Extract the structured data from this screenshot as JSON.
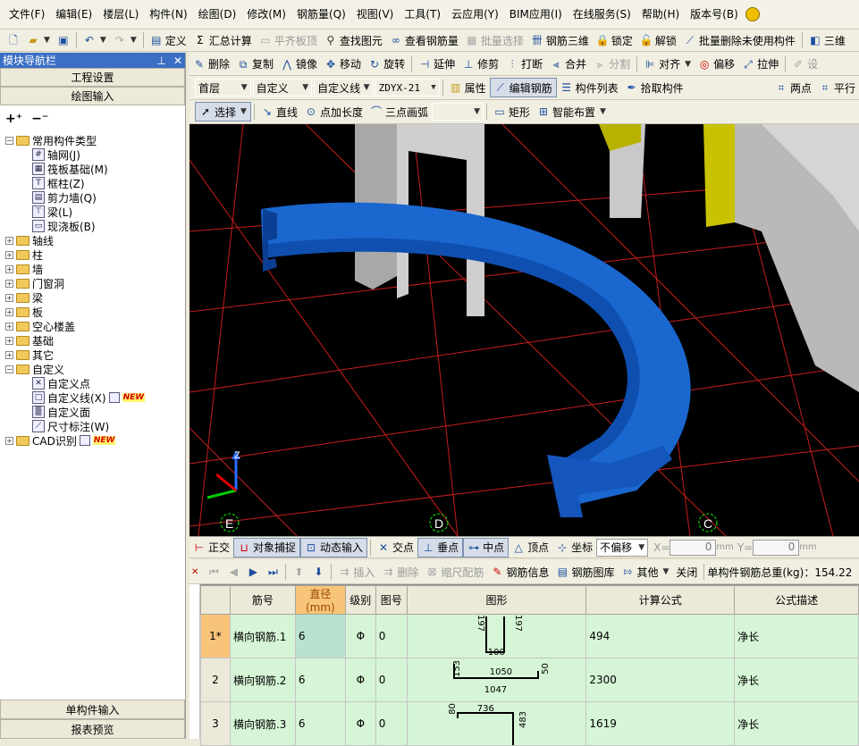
{
  "menu": [
    "文件(F)",
    "编辑(E)",
    "楼层(L)",
    "构件(N)",
    "绘图(D)",
    "修改(M)",
    "钢筋量(Q)",
    "视图(V)",
    "工具(T)",
    "云应用(Y)",
    "BIM应用(I)",
    "在线服务(S)",
    "帮助(H)",
    "版本号(B)"
  ],
  "toolbar1": {
    "define": "定义",
    "sum": "汇总计算",
    "align_slab": "平齐板顶",
    "find": "查找图元",
    "view_rebar": "查看钢筋量",
    "batch_select": "批量选择",
    "rebar_3d": "钢筋三维",
    "lock": "锁定",
    "unlock": "解锁",
    "batch_delete": "批量删除未使用构件",
    "three_d": "三维"
  },
  "nav": {
    "title": "模块导航栏",
    "btn_project": "工程设置",
    "btn_draw": "绘图输入",
    "btn_single": "单构件输入",
    "btn_report": "报表预览",
    "tree": [
      {
        "level": 1,
        "exp": "−",
        "label": "常用构件类型",
        "icon": "folder"
      },
      {
        "level": 2,
        "label": "轴网(J)",
        "icon": "grid-icon",
        "glyph": "#"
      },
      {
        "level": 2,
        "label": "筏板基础(M)",
        "icon": "raft-icon",
        "glyph": "▦"
      },
      {
        "level": 2,
        "label": "框柱(Z)",
        "icon": "column-icon",
        "glyph": "T"
      },
      {
        "level": 2,
        "label": "剪力墙(Q)",
        "icon": "shear-wall-icon",
        "glyph": "▤"
      },
      {
        "level": 2,
        "label": "梁(L)",
        "icon": "beam-icon",
        "glyph": "⊤"
      },
      {
        "level": 2,
        "label": "现浇板(B)",
        "icon": "slab-icon",
        "glyph": "▭"
      },
      {
        "level": 1,
        "exp": "+",
        "label": "轴线",
        "icon": "folder"
      },
      {
        "level": 1,
        "exp": "+",
        "label": "柱",
        "icon": "folder"
      },
      {
        "level": 1,
        "exp": "+",
        "label": "墙",
        "icon": "folder"
      },
      {
        "level": 1,
        "exp": "+",
        "label": "门窗洞",
        "icon": "folder"
      },
      {
        "level": 1,
        "exp": "+",
        "label": "梁",
        "icon": "folder"
      },
      {
        "level": 1,
        "exp": "+",
        "label": "板",
        "icon": "folder"
      },
      {
        "level": 1,
        "exp": "+",
        "label": "空心楼盖",
        "icon": "folder"
      },
      {
        "level": 1,
        "exp": "+",
        "label": "基础",
        "icon": "folder"
      },
      {
        "level": 1,
        "exp": "+",
        "label": "其它",
        "icon": "folder"
      },
      {
        "level": 1,
        "exp": "−",
        "label": "自定义",
        "icon": "folder"
      },
      {
        "level": 2,
        "label": "自定义点",
        "icon": "custom-point-icon",
        "glyph": "✕"
      },
      {
        "level": 2,
        "label": "自定义线(X)",
        "icon": "custom-line-icon",
        "glyph": "□",
        "new": "NEW"
      },
      {
        "level": 2,
        "label": "自定义面",
        "icon": "custom-face-icon",
        "glyph": "▒"
      },
      {
        "level": 2,
        "label": "尺寸标注(W)",
        "icon": "dimension-icon",
        "glyph": "⟋"
      },
      {
        "level": 1,
        "exp": "+",
        "label": "CAD识别",
        "icon": "folder",
        "new": "NEW"
      }
    ]
  },
  "toolbar2": {
    "delete": "删除",
    "copy": "复制",
    "mirror": "镜像",
    "move": "移动",
    "rotate": "旋转",
    "extend": "延伸",
    "trim": "修剪",
    "break": "打断",
    "merge": "合并",
    "split": "分割",
    "align": "对齐",
    "offset": "偏移",
    "stretch": "拉伸",
    "set": "设"
  },
  "toolbar3": {
    "floor": "首层",
    "type": "自定义",
    "subtype": "自定义线",
    "name": "ZDYX-21",
    "props": "属性",
    "edit_rebar": "编辑钢筋",
    "list": "构件列表",
    "pick": "拾取构件",
    "two_points": "两点",
    "parallel": "平行"
  },
  "toolbar4": {
    "select": "选择",
    "line": "直线",
    "point_len": "点加长度",
    "arc3": "三点画弧",
    "rect": "矩形",
    "smart": "智能布置"
  },
  "viewport": {
    "axis_labels": [
      "E",
      "D",
      "C"
    ],
    "axis_z": "Z"
  },
  "snapbar": {
    "ortho": "正交",
    "snap": "对象捕捉",
    "dyn": "动态输入",
    "cross": "交点",
    "perp": "垂点",
    "mid": "中点",
    "vertex": "顶点",
    "coord": "坐标",
    "offset_mode": "不偏移",
    "x_label": "X=",
    "x_val": "0",
    "y_label": "Y=",
    "y_val": "0",
    "unit": "mm"
  },
  "gridbar": {
    "insert": "插入",
    "delete": "删除",
    "scale": "缩尺配筋",
    "info": "钢筋信息",
    "lib": "钢筋图库",
    "other": "其他",
    "close": "关闭",
    "total": "单构件钢筋总重(kg)：154.22"
  },
  "table": {
    "headers": [
      "",
      "筋号",
      "直径(mm)",
      "级别",
      "图号",
      "图形",
      "计算公式",
      "公式描述"
    ],
    "rows": [
      {
        "idx": "1*",
        "name": "横向钢筋.1",
        "dia": "6",
        "grade": "Φ",
        "fig": "0",
        "formula": "494",
        "desc": "净长",
        "dims": [
          "197",
          "197",
          "100"
        ]
      },
      {
        "idx": "2",
        "name": "横向钢筋.2",
        "dia": "6",
        "grade": "Φ",
        "fig": "0",
        "formula": "2300",
        "desc": "净长",
        "dims": [
          "153",
          "1050",
          "50",
          "1047"
        ]
      },
      {
        "idx": "3",
        "name": "横向钢筋.3",
        "dia": "6",
        "grade": "Φ",
        "fig": "0",
        "formula": "1619",
        "desc": "净长",
        "dims": [
          "80",
          "736",
          "483"
        ]
      }
    ]
  }
}
